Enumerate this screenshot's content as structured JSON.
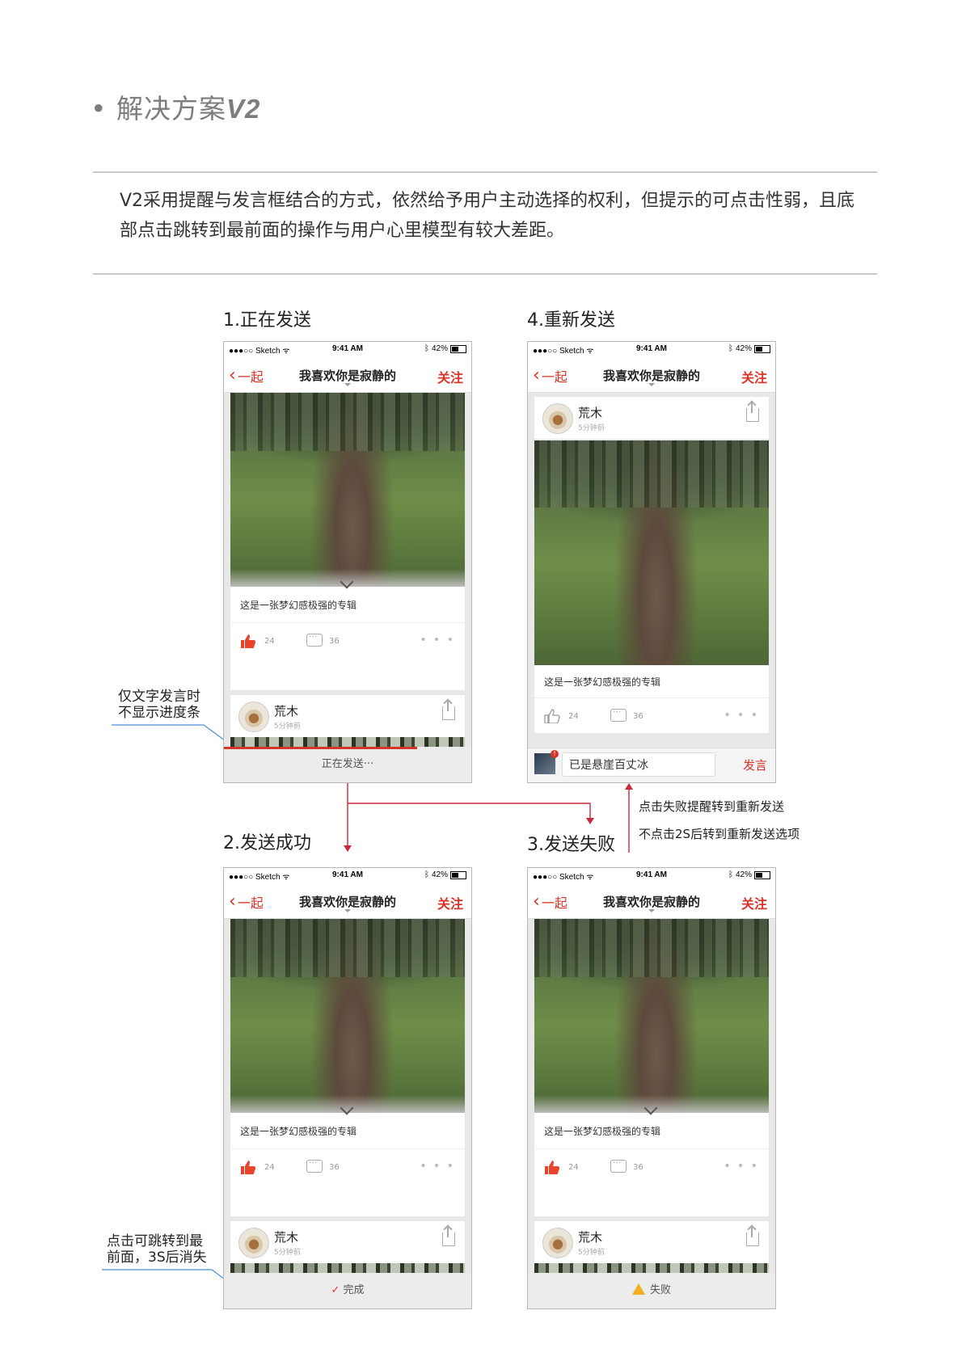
{
  "header": {
    "bullet": "•",
    "title_cn": "解决方案",
    "title_v": "V2"
  },
  "description": "V2采用提醒与发言框结合的方式，依然给予用户主动选择的权利，但提示的可点击性弱，且底部点击跳转到最前面的操作与用户心里模型有较大差距。",
  "steps": {
    "s1": "1.正在发送",
    "s2": "2.发送成功",
    "s3": "3.发送失败",
    "s4": "4.重新发送"
  },
  "notes": {
    "n1": [
      "仅文字发言时",
      "不显示进度条"
    ],
    "n2": [
      "点击可跳转到最",
      "前面，3S后消失"
    ]
  },
  "flow": {
    "f1": "点击失败提醒转到重新发送",
    "f2": "不点击2S后转到重新发送选项"
  },
  "phone": {
    "carrier": "●●●○○ Sketch ᯤ",
    "time": "9:41 AM",
    "battery": "42%",
    "back": "一起",
    "title": "我喜欢你是寂静的",
    "follow": "关注",
    "caption": "这是一张梦幻感极强的专辑",
    "likes": "24",
    "comments": "36",
    "more": "• • •",
    "user_name": "荒木",
    "user_time": "5分钟前"
  },
  "bars": {
    "sending": "正在发送···",
    "done": "完成",
    "fail": "失败",
    "input_value": "已是悬崖百丈冰",
    "send": "发言",
    "sending_progress": 0.78
  },
  "colors": {
    "accent": "#d8342a",
    "note_line": "#4a8fd8",
    "flow_line": "#c8283a"
  }
}
